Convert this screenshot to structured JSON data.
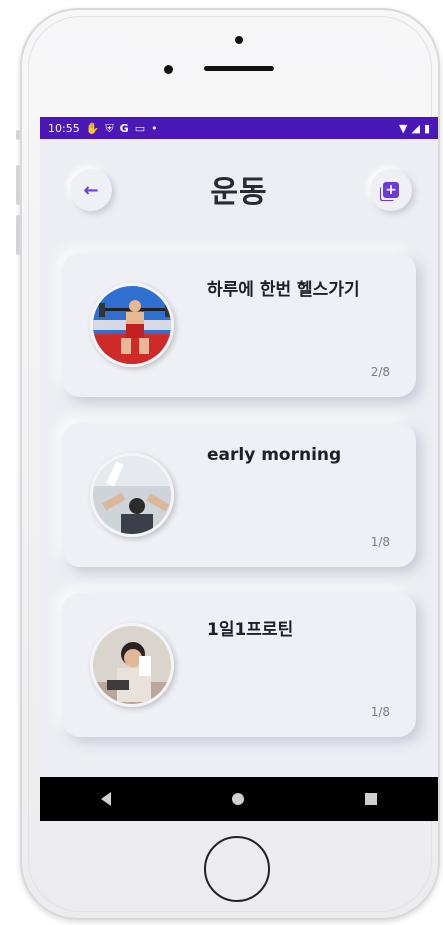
{
  "status_bar": {
    "time": "10:55",
    "icons": [
      "hand-icon",
      "shield-icon",
      "google-icon",
      "card-icon",
      "dot-icon"
    ],
    "right_icons": [
      "wifi-icon",
      "signal-icon",
      "battery-icon"
    ]
  },
  "header": {
    "title": "운동",
    "back_icon": "arrow-left-icon",
    "add_icon": "add-box-icon"
  },
  "colors": {
    "accent": "#6a3bd6",
    "status_bar": "#4a17b8",
    "background": "#edeef3"
  },
  "cards": [
    {
      "title": "하루에 한번 헬스가기",
      "count": "2/8",
      "image": "weightlifter-photo"
    },
    {
      "title": "early morning",
      "count": "1/8",
      "image": "gym-ceiling-photo"
    },
    {
      "title": "1일1프로틴",
      "count": "1/8",
      "image": "person-drinking-photo"
    }
  ],
  "nav": {
    "buttons": [
      "back-triangle-icon",
      "home-circle-icon",
      "recents-square-icon"
    ]
  }
}
